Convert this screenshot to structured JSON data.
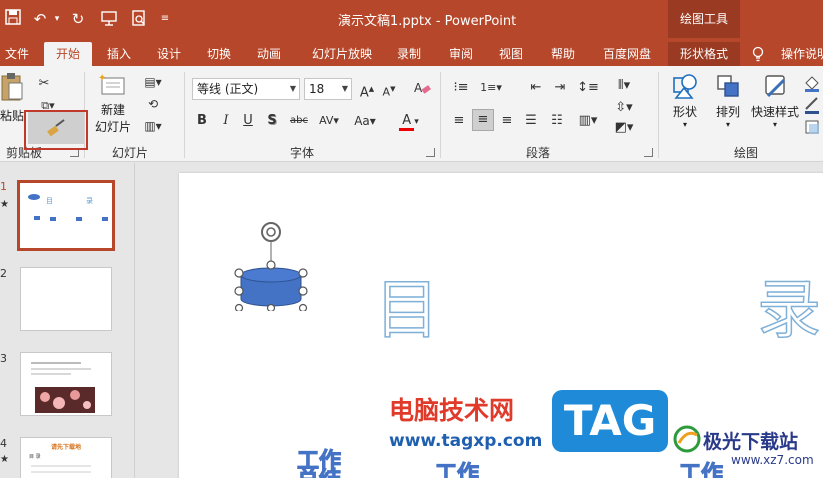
{
  "titlebar": {
    "doc_title": "演示文稿1.pptx  -  PowerPoint",
    "context_tools": "绘图工具"
  },
  "tabs": [
    {
      "label": "文件"
    },
    {
      "label": "开始"
    },
    {
      "label": "插入"
    },
    {
      "label": "设计"
    },
    {
      "label": "切换"
    },
    {
      "label": "动画"
    },
    {
      "label": "幻灯片放映"
    },
    {
      "label": "录制"
    },
    {
      "label": "审阅"
    },
    {
      "label": "视图"
    },
    {
      "label": "帮助"
    },
    {
      "label": "百度网盘"
    },
    {
      "label": "形状格式"
    },
    {
      "label": "操作说明"
    }
  ],
  "ribbon": {
    "clipboard": {
      "paste_label": "粘贴",
      "group_label": "剪贴板"
    },
    "slides": {
      "new_slide_line1": "新建",
      "new_slide_line2": "幻灯片",
      "group_label": "幻灯片"
    },
    "font": {
      "font_name": "等线 (正文)",
      "font_size": "18",
      "group_label": "字体"
    },
    "paragraph": {
      "group_label": "段落"
    },
    "drawing": {
      "shape_label": "形状",
      "arrange_label": "排列",
      "quick_styles_label": "快速样式",
      "group_label": "绘图"
    }
  },
  "thumbnails": [
    {
      "num": "1",
      "selected": true
    },
    {
      "num": "2",
      "selected": false
    },
    {
      "num": "3",
      "selected": false
    },
    {
      "num": "4",
      "selected": false
    }
  ],
  "thumb_texts": {
    "t1_mu": "目",
    "t1_lu": "录",
    "t4_title": "请先下载地",
    "t4_sub": "目 录"
  },
  "slide": {
    "char_mu": "目",
    "char_lu": "录",
    "work1": "工作",
    "work1b": "总结",
    "work2": "工作",
    "work3": "工作"
  },
  "watermark": {
    "site_name": "电脑技术网",
    "site_url": "www.tagxp.com",
    "tag": "TAG",
    "brand": "极光下载站",
    "brand_url": "www.xz7.com"
  },
  "colors": {
    "accent": "#b7472a",
    "shape_fill": "#4472c4",
    "outline_text": "#7fb0d8"
  }
}
